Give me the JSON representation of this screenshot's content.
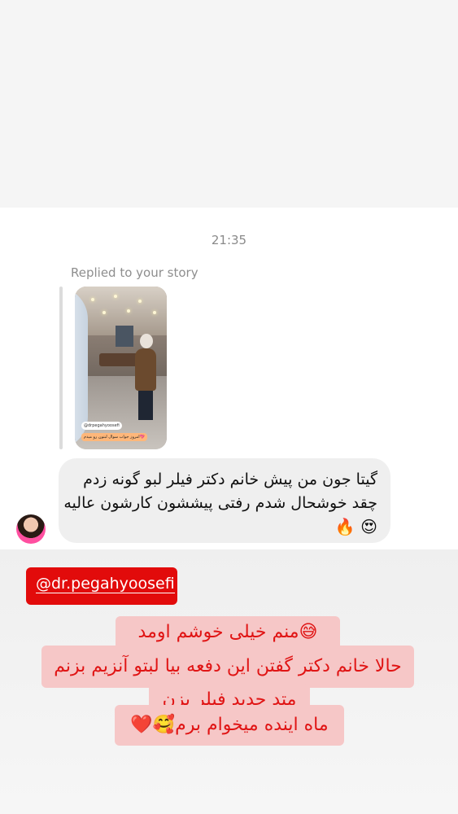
{
  "chat": {
    "timestamp": "21:35",
    "reply_label": "Replied to your story",
    "story_preview": {
      "tag_handle": "@drpegahyoosefi",
      "tag_caption": "امروز جواب سوال لبتون رو میدم💖"
    },
    "message": {
      "line1": "گیتا جون من پیش خانم دکتر فیلر لبو گونه زدم",
      "line2": "چقد خوشحال شدم رفتی پیششون کارشون عالیه",
      "line3": "😍 🔥"
    }
  },
  "overlay": {
    "mention": "@dr.pegahyoosefi",
    "lines": [
      "😅منم خیلی خوشم اومد",
      "حالا خانم دکتر گفتن این دفعه بیا لبتو آنزیم بزنم",
      "متد جدید فیلر بزن",
      "ماه اینده میخوام برم🥰❤️"
    ]
  },
  "colors": {
    "mention_bg": "#e20b0b",
    "story_text": "#e01414",
    "story_text_bg": "#f6c7c7",
    "bubble_bg": "#efefef"
  }
}
